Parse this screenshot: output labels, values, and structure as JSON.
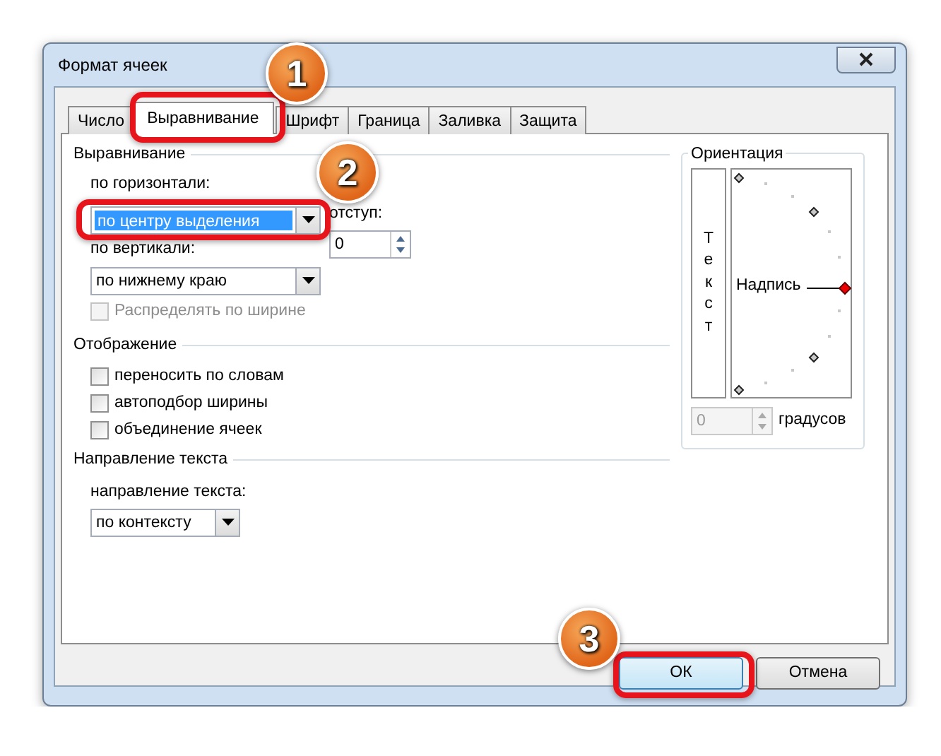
{
  "window": {
    "title": "Формат ячеек"
  },
  "tabs": [
    {
      "label": "Число",
      "selected": false
    },
    {
      "label": "Выравнивание",
      "selected": true
    },
    {
      "label": "Шрифт",
      "selected": false
    },
    {
      "label": "Граница",
      "selected": false
    },
    {
      "label": "Заливка",
      "selected": false
    },
    {
      "label": "Защита",
      "selected": false
    }
  ],
  "alignment": {
    "title": "Выравнивание",
    "horizontal_label": "по горизонтали:",
    "horizontal_value": "по центру выделения",
    "indent_label": "отступ:",
    "indent_value": "0",
    "vertical_label": "по вертикали:",
    "vertical_value": "по нижнему краю",
    "distribute": {
      "label": "Распределять по ширине",
      "checked": false,
      "disabled": true
    }
  },
  "display": {
    "title": "Отображение",
    "options": [
      {
        "label": "переносить по словам",
        "checked": false
      },
      {
        "label": "автоподбор ширины",
        "checked": false
      },
      {
        "label": "объединение ячеек",
        "checked": false
      }
    ]
  },
  "direction": {
    "title": "Направление текста",
    "label": "направление текста:",
    "value": "по контексту"
  },
  "orientation": {
    "title": "Ориентация",
    "vertical_text": "Текст",
    "dial_label": "Надпись",
    "degrees_value": "0",
    "degrees_disabled": true,
    "degrees_label": "градусов"
  },
  "buttons": [
    {
      "label": "ОК",
      "kind": "default"
    },
    {
      "label": "Отмена",
      "kind": "normal"
    }
  ],
  "callouts": [
    "1",
    "2",
    "3"
  ]
}
